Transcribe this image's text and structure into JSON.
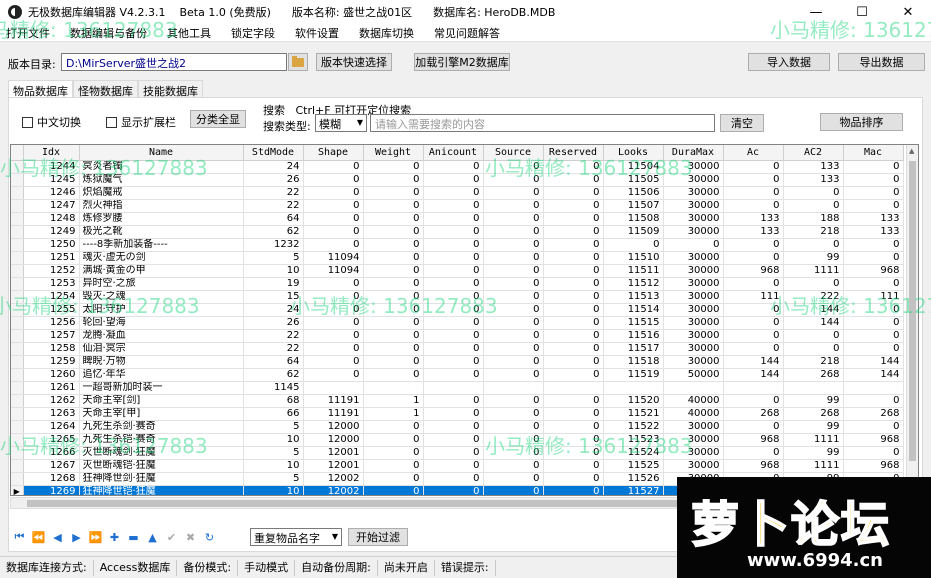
{
  "window": {
    "title": "无极数据库编辑器 V4.2.3.1    Beta 1.0 (免费版)      版本名称: 盛世之战01区      数据库名: HeroDB.MDB",
    "minimize": "—",
    "maximize": "☐",
    "close": "✕"
  },
  "menu": [
    "打开文件",
    "数据编辑与备份",
    "其他工具",
    "锁定字段",
    "软件设置",
    "数据库切换",
    "常见问题解答"
  ],
  "dir": {
    "label": "版本目录:",
    "path": "D:\\MirServer盛世之战2",
    "quick_select": "版本快速选择",
    "load_engine": "加载引擎M2数据库",
    "import": "导入数据",
    "export": "导出数据"
  },
  "tabs": [
    "物品数据库",
    "怪物数据库",
    "技能数据库"
  ],
  "options": {
    "chinese_switch": "中文切换",
    "show_ext": "显示扩展栏",
    "show_all": "分类全显"
  },
  "search": {
    "title": "搜索   Ctrl+F 可打开定位搜索",
    "type_label": "搜索类型:",
    "type_value": "模糊",
    "placeholder": "请输入需要搜索的内容",
    "clear": "清空",
    "sort": "物品排序"
  },
  "table": {
    "columns": [
      "Idx",
      "Name",
      "StdMode",
      "Shape",
      "Weight",
      "Anicount",
      "Source",
      "Reserved",
      "Looks",
      "DuraMax",
      "Ac",
      "AC2",
      "Mac"
    ],
    "rows": [
      [
        "1244",
        "冥炎者镯",
        "24",
        "0",
        "0",
        "0",
        "0",
        "0",
        "11504",
        "30000",
        "0",
        "133",
        "0"
      ],
      [
        "1245",
        "炼狱魔气",
        "26",
        "0",
        "0",
        "0",
        "0",
        "0",
        "11505",
        "30000",
        "0",
        "133",
        "0"
      ],
      [
        "1246",
        "炽焰魔戒",
        "22",
        "0",
        "0",
        "0",
        "0",
        "0",
        "11506",
        "30000",
        "0",
        "0",
        "0"
      ],
      [
        "1247",
        "烈火神指",
        "22",
        "0",
        "0",
        "0",
        "0",
        "0",
        "11507",
        "30000",
        "0",
        "0",
        "0"
      ],
      [
        "1248",
        "炼修罗腰",
        "64",
        "0",
        "0",
        "0",
        "0",
        "0",
        "11508",
        "30000",
        "133",
        "188",
        "133"
      ],
      [
        "1249",
        "极光之靴",
        "62",
        "0",
        "0",
        "0",
        "0",
        "0",
        "11509",
        "30000",
        "133",
        "218",
        "133"
      ],
      [
        "1250",
        "----8季新加装备----",
        "1232",
        "0",
        "0",
        "0",
        "0",
        "0",
        "0",
        "0",
        "0",
        "0",
        "0"
      ],
      [
        "1251",
        "魂灭·虚无の剑",
        "5",
        "11094",
        "0",
        "0",
        "0",
        "0",
        "11510",
        "30000",
        "0",
        "99",
        "0"
      ],
      [
        "1252",
        "满城·黄金の甲",
        "10",
        "11094",
        "0",
        "0",
        "0",
        "0",
        "11511",
        "30000",
        "968",
        "1111",
        "968"
      ],
      [
        "1253",
        "异时空·之旅",
        "19",
        "0",
        "0",
        "0",
        "0",
        "0",
        "11512",
        "30000",
        "0",
        "0",
        "0"
      ],
      [
        "1254",
        "毁灭·之魂",
        "15",
        "0",
        "0",
        "0",
        "0",
        "0",
        "11513",
        "30000",
        "111",
        "222",
        "111"
      ],
      [
        "1255",
        "太阳·守护",
        "24",
        "0",
        "0",
        "0",
        "0",
        "0",
        "11514",
        "30000",
        "0",
        "144",
        "0"
      ],
      [
        "1256",
        "轮回·望海",
        "26",
        "0",
        "0",
        "0",
        "0",
        "0",
        "11515",
        "30000",
        "0",
        "144",
        "0"
      ],
      [
        "1257",
        "龙腾·凝血",
        "22",
        "0",
        "0",
        "0",
        "0",
        "0",
        "11516",
        "30000",
        "0",
        "0",
        "0"
      ],
      [
        "1258",
        "仙泪·冥宗",
        "22",
        "0",
        "0",
        "0",
        "0",
        "0",
        "11517",
        "30000",
        "0",
        "0",
        "0"
      ],
      [
        "1259",
        "睥睨·万物",
        "64",
        "0",
        "0",
        "0",
        "0",
        "0",
        "11518",
        "30000",
        "144",
        "218",
        "144"
      ],
      [
        "1260",
        "追忆·年华",
        "62",
        "0",
        "0",
        "0",
        "0",
        "0",
        "11519",
        "50000",
        "144",
        "268",
        "144"
      ],
      [
        "1261",
        "一超哥新加时装一",
        "1145",
        "",
        "",
        "",
        "",
        "",
        "",
        "",
        "",
        "",
        ""
      ],
      [
        "1262",
        "天命主宰[剑]",
        "68",
        "11191",
        "1",
        "0",
        "0",
        "0",
        "11520",
        "40000",
        "0",
        "99",
        "0"
      ],
      [
        "1263",
        "天命主宰[甲]",
        "66",
        "11191",
        "1",
        "0",
        "0",
        "0",
        "11521",
        "40000",
        "268",
        "268",
        "268"
      ],
      [
        "1264",
        "九死生杀剑·赛奇",
        "5",
        "12000",
        "0",
        "0",
        "0",
        "0",
        "11522",
        "30000",
        "0",
        "99",
        "0"
      ],
      [
        "1265",
        "九死生杀铠·赛奇",
        "10",
        "12000",
        "0",
        "0",
        "0",
        "0",
        "11523",
        "30000",
        "968",
        "1111",
        "968"
      ],
      [
        "1266",
        "灭世断魂剑·狂魔",
        "5",
        "12001",
        "0",
        "0",
        "0",
        "0",
        "11524",
        "30000",
        "0",
        "99",
        "0"
      ],
      [
        "1267",
        "灭世断魂铠·狂魔",
        "10",
        "12001",
        "0",
        "0",
        "0",
        "0",
        "11525",
        "30000",
        "968",
        "1111",
        "968"
      ],
      [
        "1268",
        "狂神降世剑·狂魔",
        "5",
        "12002",
        "0",
        "0",
        "0",
        "0",
        "11526",
        "30000",
        "0",
        "99",
        "0"
      ],
      [
        "1269",
        "狂神降世铠·狂魔",
        "10",
        "12002",
        "0",
        "0",
        "0",
        "0",
        "11527",
        "",
        "",
        "",
        ""
      ]
    ],
    "selected_row_marker": "▶"
  },
  "nav_icons": [
    "first-icon",
    "prev-icon",
    "next-icon",
    "last-icon",
    "add-icon",
    "delete-icon",
    "up-icon",
    "confirm-icon",
    "cancel-icon",
    "refresh-icon"
  ],
  "bottom": {
    "dup_name": "重复物品名字",
    "start_filter": "开始过滤"
  },
  "status": {
    "conn_label": "数据库连接方式:",
    "conn_value": "Access数据库",
    "backup_label": "备份模式:",
    "backup_value": "手动模式",
    "auto_label": "自动备份周期:",
    "auto_value": "尚未开启",
    "error_label": "错误提示:"
  },
  "watermark": "小马精修: 136127883",
  "logo": {
    "text": "萝卜论坛",
    "url": "www.6994.cn"
  }
}
